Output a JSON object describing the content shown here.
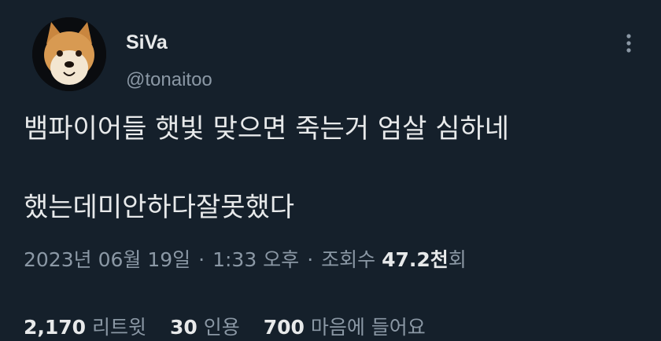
{
  "author": {
    "name": "SiVa",
    "handle": "@tonaitoo"
  },
  "tweet": {
    "line1": "뱀파이어들 햇빛 맞으면 죽는거 엄살 심하네",
    "line2": "했는데미안하다잘못했다"
  },
  "meta": {
    "date": "2023년 06월 19일",
    "separator": "·",
    "time": "1:33 오후",
    "views_label": "조회수",
    "views_count": "47.2천",
    "views_suffix": "회"
  },
  "stats": {
    "retweets_count": "2,170",
    "retweets_label": "리트윗",
    "quotes_count": "30",
    "quotes_label": "인용",
    "likes_count": "700",
    "likes_label": "마음에 들어요"
  },
  "colors": {
    "background": "#15202b",
    "text_primary": "#e7e9ea",
    "text_secondary": "#8b98a5"
  }
}
